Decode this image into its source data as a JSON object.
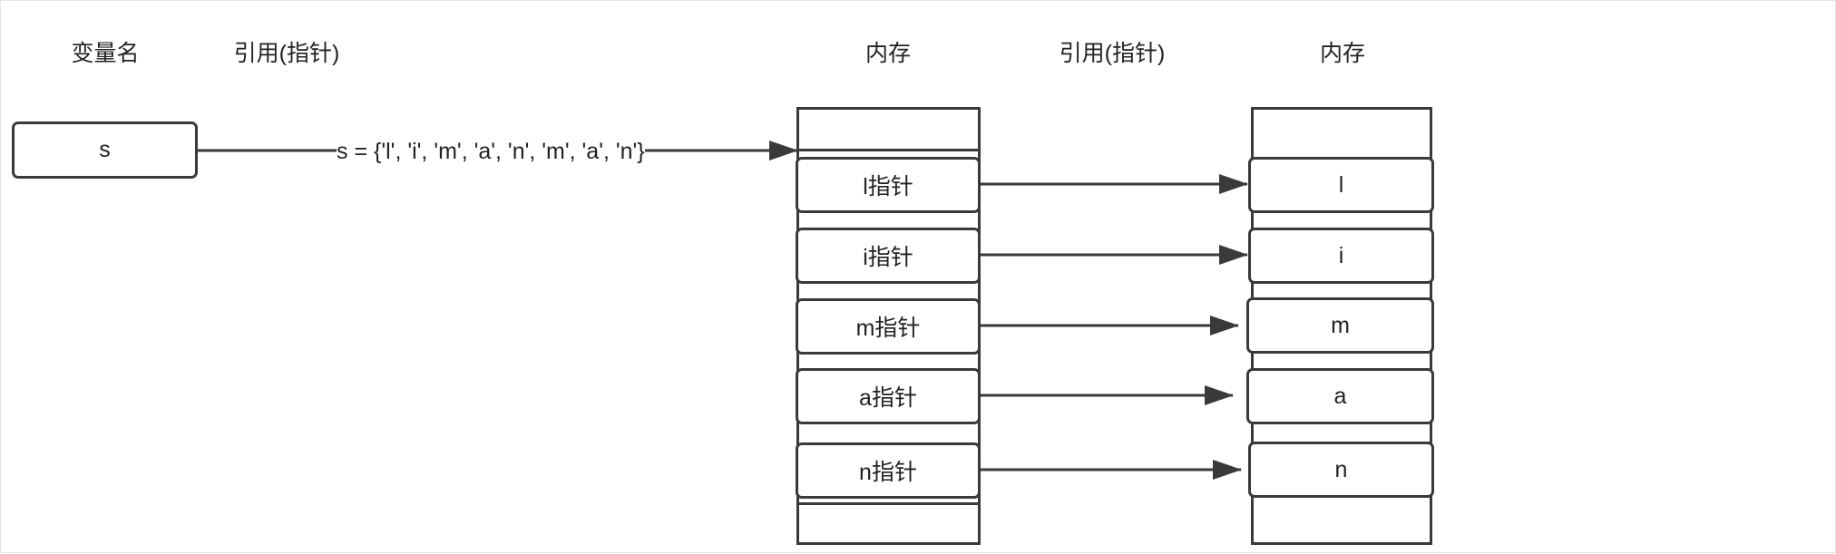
{
  "headers": {
    "var_name": "变量名",
    "ref1": "引用(指针)",
    "mem1": "内存",
    "ref2": "引用(指针)",
    "mem2": "内存"
  },
  "variable": {
    "label": "s"
  },
  "formula": "s = {'l', 'i', 'm', 'a', 'n', 'm', 'a', 'n'}",
  "pointers": [
    "l指针",
    "i指针",
    "m指针",
    "a指针",
    "n指针"
  ],
  "values": [
    "l",
    "i",
    "m",
    "a",
    "n"
  ]
}
